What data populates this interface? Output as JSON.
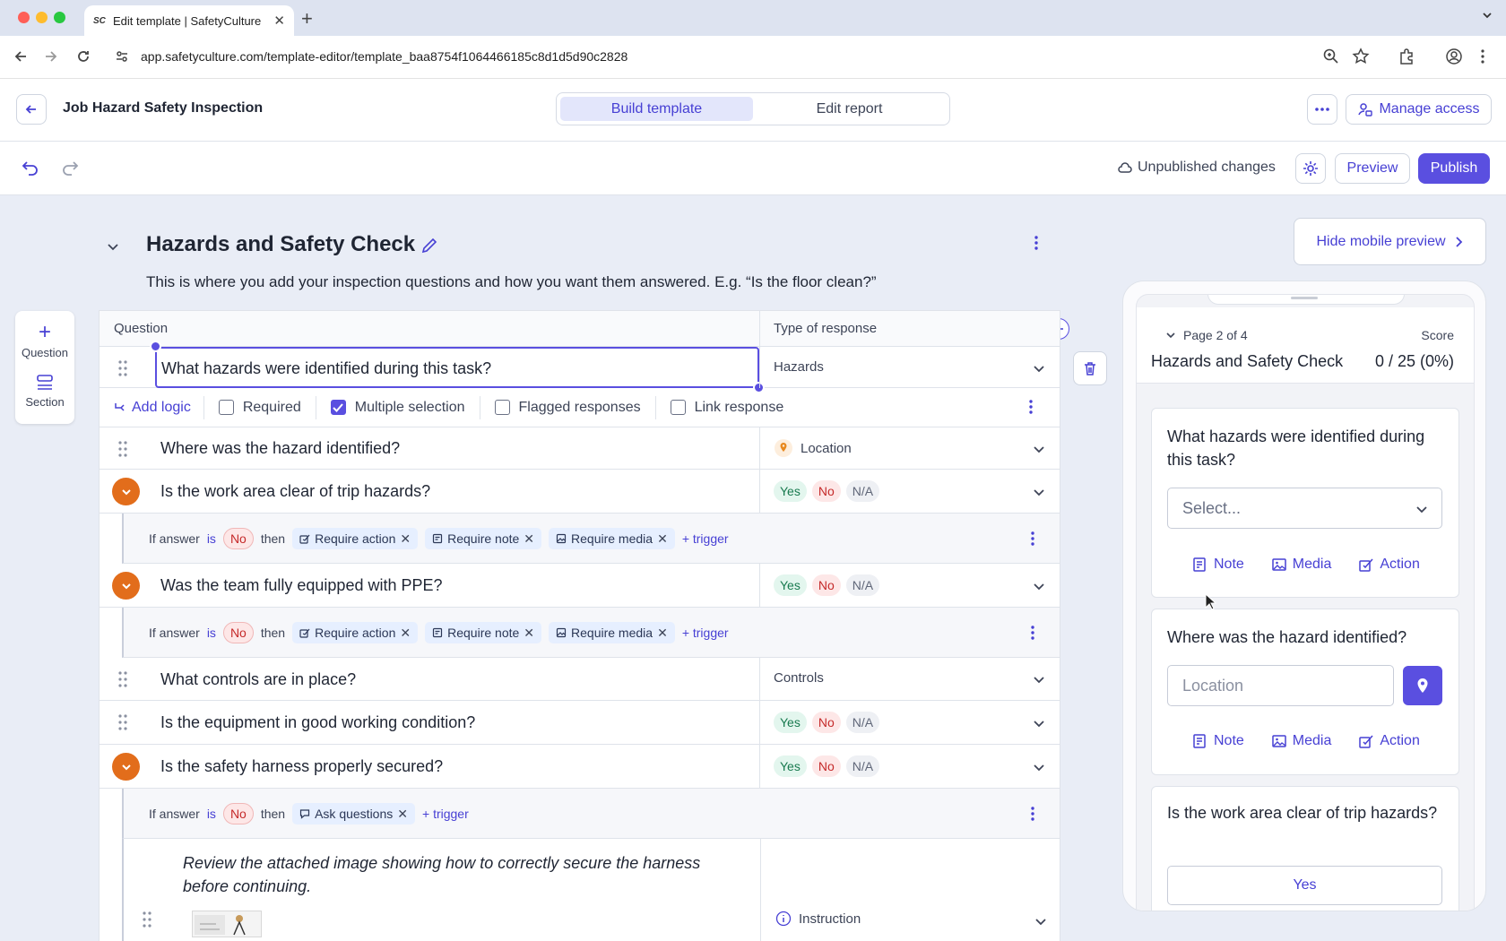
{
  "browser": {
    "tab_title": "Edit template | SafetyCulture",
    "tab_favicon": "SC",
    "url": "app.safetyculture.com/template-editor/template_baa8754f1064466185c8d1d5d90c2828"
  },
  "header": {
    "title": "Job Hazard Safety Inspection",
    "mode_tabs": [
      {
        "label": "Build template",
        "active": true
      },
      {
        "label": "Edit report",
        "active": false
      }
    ],
    "manage_access": "Manage access"
  },
  "toolbar": {
    "status": "Unpublished changes",
    "preview": "Preview",
    "publish": "Publish"
  },
  "palette": {
    "question": "Question",
    "section": "Section"
  },
  "section": {
    "title": "Hazards and Safety Check",
    "description": "This is where you add your inspection questions and how you want them answered. E.g. “Is the floor clean?”"
  },
  "table": {
    "col_question": "Question",
    "col_response": "Type of response",
    "selected_question": {
      "text": "What hazards were identified during this task?",
      "response": "Hazards",
      "add_logic": "Add logic",
      "options": [
        {
          "label": "Required",
          "checked": false
        },
        {
          "label": "Multiple selection",
          "checked": true
        },
        {
          "label": "Flagged responses",
          "checked": false
        },
        {
          "label": "Link response",
          "checked": false
        }
      ]
    },
    "rows": [
      {
        "text": "Where was the hazard identified?",
        "response": "Location"
      },
      {
        "text": "Is the work area clear of trip hazards?",
        "yes": "Yes",
        "no": "No",
        "na": "N/A"
      },
      {
        "text": "Was the team fully equipped with PPE?",
        "yes": "Yes",
        "no": "No",
        "na": "N/A"
      },
      {
        "text": "What controls are in place?",
        "response": "Controls"
      },
      {
        "text": "Is the equipment in good working condition?",
        "yes": "Yes",
        "no": "No",
        "na": "N/A"
      },
      {
        "text": "Is the safety harness properly secured?",
        "yes": "Yes",
        "no": "No",
        "na": "N/A"
      }
    ],
    "logic": {
      "if_answer": "If answer",
      "is": "is",
      "answer": "No",
      "then": "then",
      "require_action": "Require action",
      "require_note": "Require note",
      "require_media": "Require media",
      "ask_questions": "Ask questions",
      "trigger": "+ trigger"
    },
    "instruction": {
      "text": "Review the attached image showing how to correctly secure the harness before continuing.",
      "response": "Instruction"
    }
  },
  "preview": {
    "hide_label": "Hide mobile preview",
    "page": "Page 2 of 4",
    "score_label": "Score",
    "section_title": "Hazards and Safety Check",
    "score": "0 / 25 (0%)",
    "q1": "What hazards were identified during this task?",
    "select_placeholder": "Select...",
    "note": "Note",
    "media": "Media",
    "action": "Action",
    "q2": "Where was the hazard identified?",
    "location_placeholder": "Location",
    "q3": "Is the work area clear of trip hazards?",
    "yes": "Yes"
  },
  "colors": {
    "accent": "#5a4fe0",
    "logic_toggle": "#e26d1b",
    "yes": "#187a4f",
    "no": "#c52a2a"
  }
}
